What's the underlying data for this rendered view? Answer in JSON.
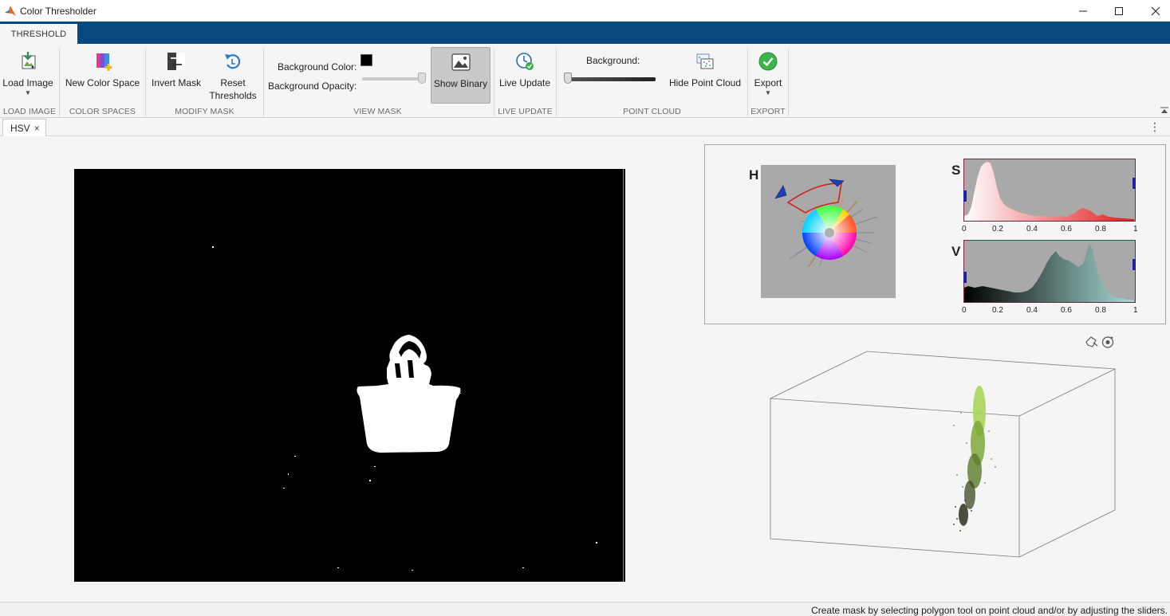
{
  "window": {
    "title": "Color Thresholder"
  },
  "tabs": {
    "threshold": "THRESHOLD"
  },
  "ribbon": {
    "load_image": {
      "label": "Load Image",
      "caption": "LOAD IMAGE"
    },
    "color_spaces": {
      "new_color_space": "New Color Space",
      "caption": "COLOR SPACES"
    },
    "modify_mask": {
      "invert_mask": "Invert Mask",
      "reset_line1": "Reset",
      "reset_line2": "Thresholds",
      "caption": "MODIFY MASK"
    },
    "view_mask": {
      "background_color_label": "Background Color:",
      "background_color_value": "#000000",
      "background_opacity_label": "Background Opacity:",
      "background_opacity_level": 1.0,
      "show_binary": "Show Binary",
      "caption": "VIEW MASK"
    },
    "live_update": {
      "label": "Live Update",
      "caption": "LIVE UPDATE"
    },
    "point_cloud": {
      "background_label": "Background:",
      "background_level": 0.0,
      "hide_point_cloud": "Hide Point Cloud",
      "caption": "POINT CLOUD"
    },
    "export": {
      "label": "Export",
      "caption": "EXPORT"
    }
  },
  "document_tab": {
    "label": "HSV",
    "close": "×"
  },
  "histograms": {
    "h_label": "H",
    "s_label": "S",
    "v_label": "V",
    "ticks": [
      "0",
      "0.2",
      "0.4",
      "0.6",
      "0.8",
      "1"
    ]
  },
  "status": {
    "message": "Create mask by selecting polygon tool on point cloud and/or by adjusting the sliders."
  },
  "colors": {
    "accent_blue": "#074880",
    "threshold_marker": "#1f1fa8",
    "saturation_color": "#e31a1c",
    "value_color": "#a9d9d3",
    "point_cloud_green": "#8bbf3b"
  },
  "icons": {
    "load_image": "load-image-icon",
    "new_color_space": "new-color-space-icon",
    "invert_mask": "invert-mask-icon",
    "reset_thresholds": "reset-icon",
    "show_binary": "binary-image-icon",
    "live_update": "clock-check-icon",
    "hide_point_cloud": "point-cloud-icon",
    "export": "check-circle-icon"
  }
}
